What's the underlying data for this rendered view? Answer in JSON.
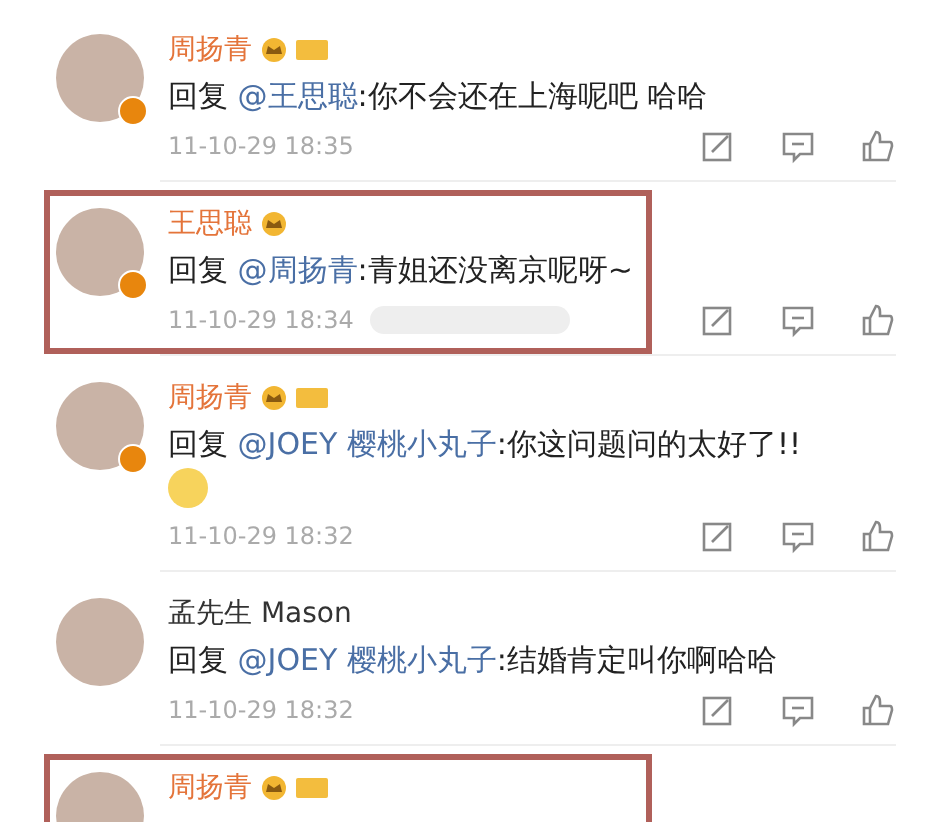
{
  "comments": [
    {
      "name": "周扬青",
      "vip": true,
      "verified": true,
      "badges": [
        {
          "kind": "crown"
        },
        {
          "kind": "tag"
        }
      ],
      "highlighted": false,
      "prefix": "回复",
      "mention": "@王思聪",
      "text": ":你不会还在上海呢吧 哈哈",
      "emoji": false,
      "redacted": false,
      "time": "11-10-29 18:35"
    },
    {
      "name": "王思聪",
      "vip": true,
      "verified": true,
      "badges": [
        {
          "kind": "crown"
        }
      ],
      "highlighted": true,
      "prefix": "回复",
      "mention": "@周扬青",
      "text": ":青姐还没离京呢呀~",
      "emoji": false,
      "redacted": true,
      "time": "11-10-29 18:34"
    },
    {
      "name": "周扬青",
      "vip": true,
      "verified": true,
      "badges": [
        {
          "kind": "crown"
        },
        {
          "kind": "tag"
        }
      ],
      "highlighted": false,
      "prefix": "回复",
      "mention": "@JOEY 樱桃小丸子",
      "text": ":你这问题问的太好了!!",
      "emoji": true,
      "redacted": false,
      "time": "11-10-29 18:32"
    },
    {
      "name": "孟先生 Mason",
      "vip": false,
      "verified": false,
      "highlighted": false,
      "prefix": "回复",
      "mention": "@JOEY 樱桃小丸子",
      "text": ":结婚肯定叫你啊哈哈",
      "emoji": false,
      "redacted": false,
      "time": "11-10-29 18:32"
    },
    {
      "name": "周扬青",
      "vip": true,
      "badges": [
        {
          "kind": "crown"
        },
        {
          "kind": "tag"
        }
      ],
      "highlighted": true
    }
  ]
}
